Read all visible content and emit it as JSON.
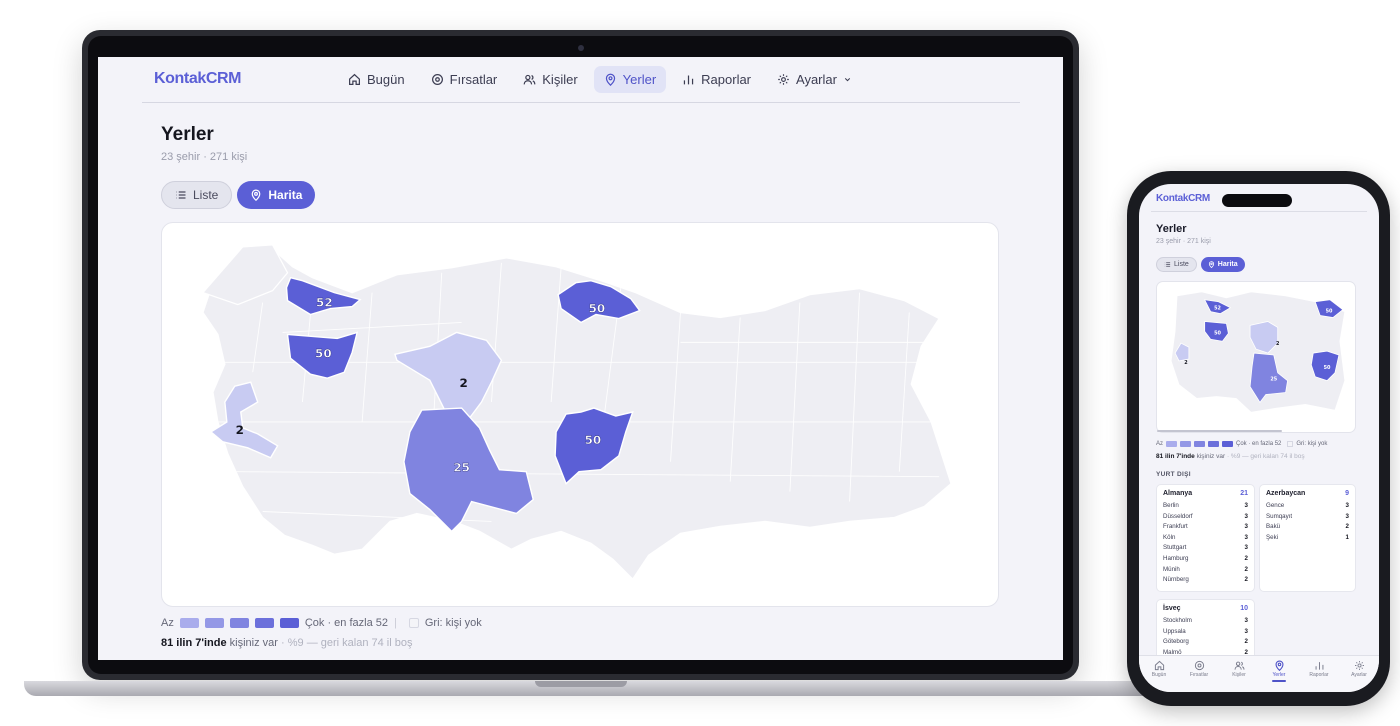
{
  "laptop": {
    "brand": "KontakCRM",
    "nav": [
      {
        "label": "Bugün",
        "icon": "home-icon",
        "active": false
      },
      {
        "label": "Fırsatlar",
        "icon": "target-icon",
        "active": false
      },
      {
        "label": "Kişiler",
        "icon": "users-icon",
        "active": false
      },
      {
        "label": "Yerler",
        "icon": "map-pin-icon",
        "active": true
      },
      {
        "label": "Raporlar",
        "icon": "bar-chart-icon",
        "active": false
      },
      {
        "label": "Ayarlar",
        "icon": "gear-icon",
        "active": false
      }
    ],
    "page": {
      "title": "Yerler",
      "subtitle": "23 şehir · 271 kişi"
    },
    "view_toggle": {
      "list_label": "Liste",
      "map_label": "Harita",
      "selected": "Harita"
    },
    "map": {
      "labels": [
        "52",
        "50",
        "50",
        "2",
        "2",
        "25",
        "50"
      ]
    },
    "legend": {
      "low": "Az",
      "high": "Çok · en fazla 52",
      "empty": "Gri: kişi yok",
      "colors": [
        "#a9acec",
        "#9498e6",
        "#8084e0",
        "#6c70db",
        "#5b5fd6"
      ]
    },
    "summary": {
      "bold": "81 ilin 7'inde",
      "text": "kişiniz var",
      "muted": "· %9 — geri kalan 74 il boş"
    }
  },
  "phone": {
    "brand": "KontakCRM",
    "page": {
      "title": "Yerler",
      "subtitle": "23 şehir · 271 kişi"
    },
    "view_toggle": {
      "list_label": "Liste",
      "map_label": "Harita"
    },
    "map": {
      "labels": [
        "52",
        "50",
        "50",
        "2",
        "2",
        "25",
        "50"
      ]
    },
    "legend": {
      "low": "Az",
      "high": "Çok · en fazla 52",
      "empty": "Gri: kişi yok"
    },
    "summary": {
      "bold": "81 ilin 7'inde",
      "text": "kişiniz var",
      "muted": "· %9 — geri kalan 74 il boş"
    },
    "abroad_title": "YURT DIŞI",
    "countries": [
      {
        "name": "Almanya",
        "count": "21",
        "cities": [
          [
            "Berlin",
            "3"
          ],
          [
            "Düsseldorf",
            "3"
          ],
          [
            "Frankfurt",
            "3"
          ],
          [
            "Köln",
            "3"
          ],
          [
            "Stuttgart",
            "3"
          ],
          [
            "Hamburg",
            "2"
          ],
          [
            "Münih",
            "2"
          ],
          [
            "Nürnberg",
            "2"
          ]
        ]
      },
      {
        "name": "Azerbaycan",
        "count": "9",
        "cities": [
          [
            "Gence",
            "3"
          ],
          [
            "Sumqayıt",
            "3"
          ],
          [
            "Bakü",
            "2"
          ],
          [
            "Şeki",
            "1"
          ]
        ]
      },
      {
        "name": "İsveç",
        "count": "10",
        "cities": [
          [
            "Stockholm",
            "3"
          ],
          [
            "Uppsala",
            "3"
          ],
          [
            "Göteborg",
            "2"
          ],
          [
            "Malmö",
            "2"
          ]
        ]
      }
    ],
    "tabs": [
      {
        "label": "Bugün",
        "icon": "home-icon"
      },
      {
        "label": "Fırsatlar",
        "icon": "target-icon"
      },
      {
        "label": "Kişiler",
        "icon": "users-icon"
      },
      {
        "label": "Yerler",
        "icon": "map-pin-icon",
        "active": true
      },
      {
        "label": "Raporlar",
        "icon": "bar-chart-icon"
      },
      {
        "label": "Ayarlar",
        "icon": "gear-icon"
      }
    ]
  }
}
